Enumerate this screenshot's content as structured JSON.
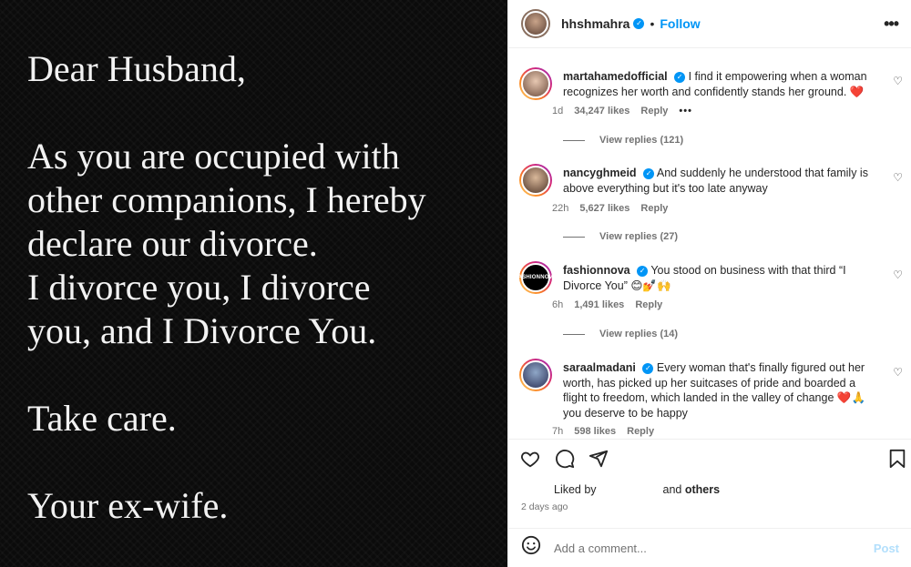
{
  "post": {
    "letter": {
      "greeting": "Dear Husband,",
      "line1": "As you are occupied with",
      "line2": "other companions, I hereby",
      "line3": "declare our divorce.",
      "line4": "I divorce you, I divorce",
      "line5": "you, and I Divorce You.",
      "closing": "Take care.",
      "signature": "Your ex-wife."
    }
  },
  "header": {
    "username": "hhshmahra",
    "separator": "•",
    "follow_label": "Follow",
    "more_label": "•••"
  },
  "comments": [
    {
      "username": "martahamedofficial",
      "text": "I find it empowering when a woman recognizes her worth and confidently stands her ground.",
      "emoji": "❤️",
      "time": "1d",
      "likes": "34,247 likes",
      "reply_label": "Reply",
      "options": "•••",
      "view_replies": "View replies (121)"
    },
    {
      "username": "nancyghmeid",
      "text": "And suddenly he understood that family is above everything but it's too late anyway",
      "emoji": "",
      "time": "22h",
      "likes": "5,627 likes",
      "reply_label": "Reply",
      "view_replies": "View replies (27)"
    },
    {
      "username": "fashionnova",
      "avatar_text": "FASHIONNOVA",
      "text": "You stood on business with that third “I Divorce You”",
      "emoji": "😊💅🙌",
      "time": "6h",
      "likes": "1,491 likes",
      "reply_label": "Reply",
      "view_replies": "View replies (14)"
    },
    {
      "username": "saraalmadani",
      "text": "Every woman that's finally figured out her worth, has picked up her suitcases of pride and boarded a flight to freedom, which landed in the valley of change",
      "emoji": "❤️🙏",
      "text2": "you deserve to be happy",
      "time": "7h",
      "likes": "598 likes",
      "reply_label": "Reply"
    }
  ],
  "likes_summary": {
    "liked_by": "Liked by",
    "and": "and",
    "others": "others"
  },
  "timestamp": "2 days ago",
  "add_comment": {
    "placeholder": "Add a comment...",
    "post_label": "Post"
  },
  "icons": {
    "heart": "♡",
    "comment": "comment-icon",
    "share": "share-icon",
    "save": "bookmark-icon",
    "emoji": "☺"
  }
}
